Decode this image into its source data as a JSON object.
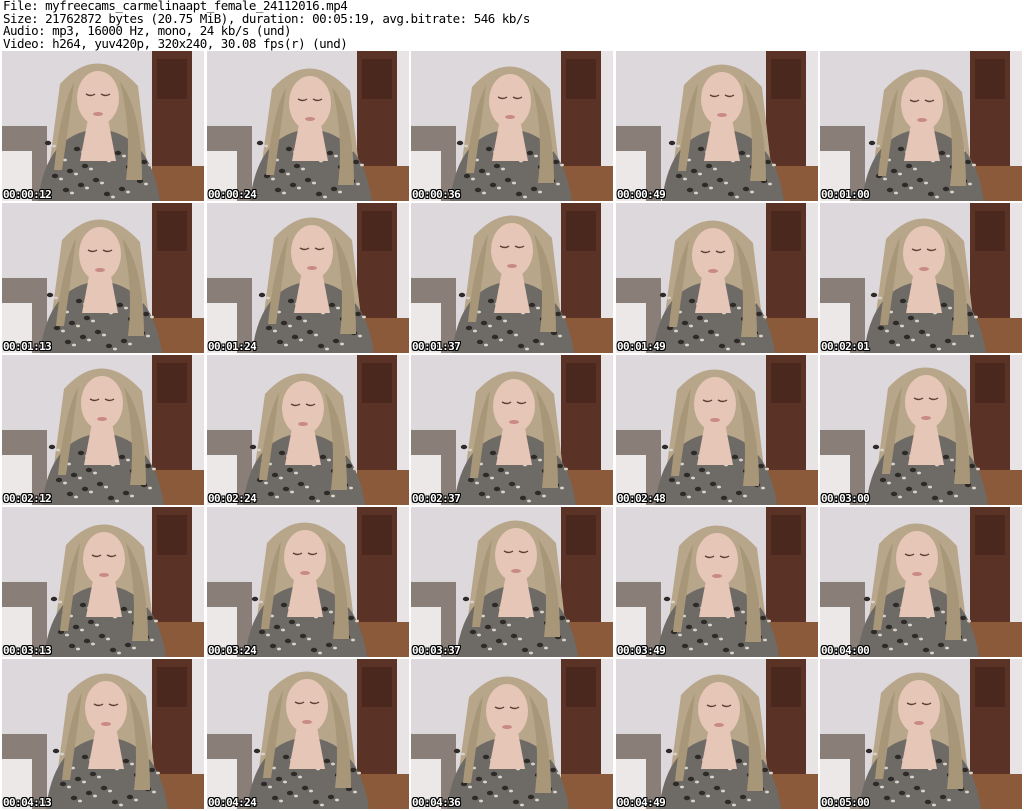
{
  "header": {
    "file_line": "File: myfreecams_carmelinaapt_female_24112016.mp4",
    "size_line": "Size: 21762872 bytes (20.75 MiB), duration: 00:05:19, avg.bitrate: 546 kb/s",
    "audio_line": "Audio: mp3, 16000 Hz, mono, 24 kb/s (und)",
    "video_line": "Video: h264, yuv420p, 320x240, 30.08 fps(r) (und)"
  },
  "thumbnails": [
    {
      "timestamp": "00:00:12"
    },
    {
      "timestamp": "00:00:24"
    },
    {
      "timestamp": "00:00:36"
    },
    {
      "timestamp": "00:00:49"
    },
    {
      "timestamp": "00:01:00"
    },
    {
      "timestamp": "00:01:13"
    },
    {
      "timestamp": "00:01:24"
    },
    {
      "timestamp": "00:01:37"
    },
    {
      "timestamp": "00:01:49"
    },
    {
      "timestamp": "00:02:01"
    },
    {
      "timestamp": "00:02:12"
    },
    {
      "timestamp": "00:02:24"
    },
    {
      "timestamp": "00:02:37"
    },
    {
      "timestamp": "00:02:48"
    },
    {
      "timestamp": "00:03:00"
    },
    {
      "timestamp": "00:03:13"
    },
    {
      "timestamp": "00:03:24"
    },
    {
      "timestamp": "00:03:37"
    },
    {
      "timestamp": "00:03:49"
    },
    {
      "timestamp": "00:04:00"
    },
    {
      "timestamp": "00:04:13"
    },
    {
      "timestamp": "00:04:24"
    },
    {
      "timestamp": "00:04:36"
    },
    {
      "timestamp": "00:04:49"
    },
    {
      "timestamp": "00:05:00"
    }
  ],
  "colors": {
    "wall": "#ddd8dc",
    "door": "#5a3226",
    "hair": "#b8a68a",
    "skin": "#e6c6b6",
    "top": "#6e6a66",
    "sofa": "#8a7e78"
  }
}
